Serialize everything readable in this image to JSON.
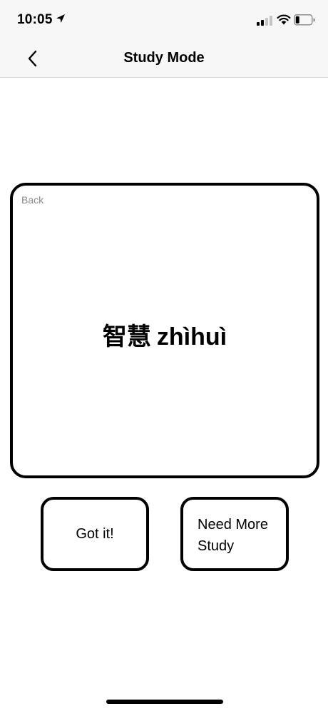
{
  "status_bar": {
    "time": "10:05",
    "icons": [
      "location-arrow-icon",
      "cellular-signal-icon",
      "wifi-icon",
      "battery-icon"
    ]
  },
  "nav": {
    "title": "Study Mode",
    "back_icon": "chevron-left-icon"
  },
  "card": {
    "side_label": "Back",
    "term_hanzi": "智慧",
    "term_pinyin": "zhìhuì"
  },
  "buttons": {
    "got_it": "Got it!",
    "need_more_study": "Need More Study"
  }
}
